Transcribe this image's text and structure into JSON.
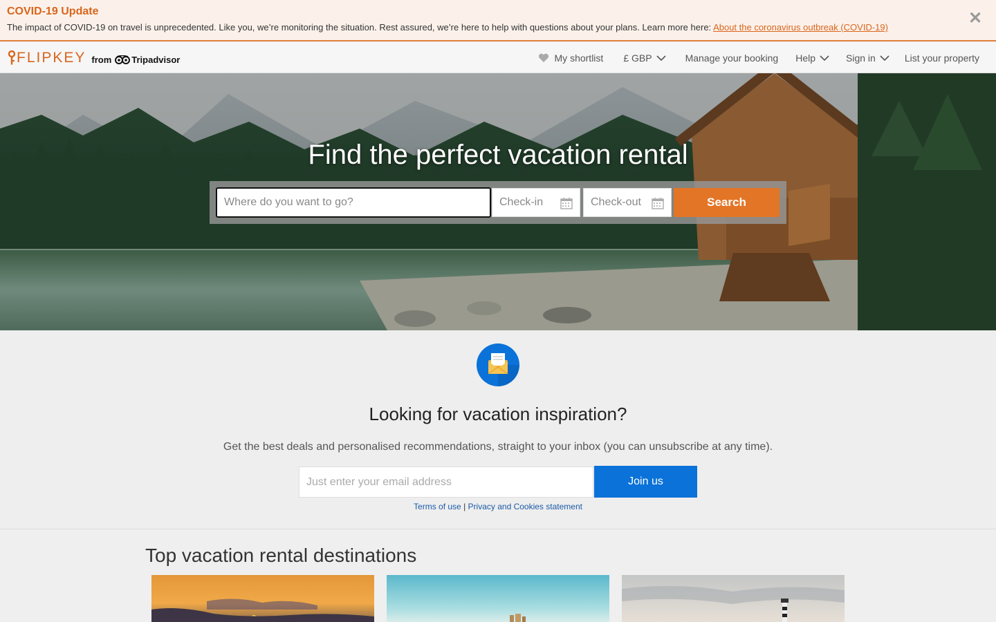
{
  "covid": {
    "title": "COVID-19 Update",
    "text": "The impact of COVID-19 on travel is unprecedented. Like you, we’re monitoring the situation. Rest assured, we’re here to help with questions about your plans. Learn more here: ",
    "link": "About the coronavirus outbreak (COVID-19)",
    "close_icon": "close-icon",
    "close_glyph": "✕"
  },
  "header": {
    "logo": "FLIPKEY",
    "logo_from": "from",
    "logo_brand": "Tripadvisor",
    "nav": {
      "shortlist": "My shortlist",
      "currency": "£ GBP",
      "manage": "Manage your booking",
      "help": "Help",
      "signin": "Sign in",
      "list": "List your property"
    }
  },
  "hero": {
    "title": "Find the perfect vacation rental",
    "where_placeholder": "Where do you want to go?",
    "checkin_placeholder": "Check-in",
    "checkout_placeholder": "Check-out",
    "search_label": "Search"
  },
  "newsletter": {
    "title": "Looking for vacation inspiration?",
    "subtitle": "Get the best deals and personalised recommendations, straight to your inbox (you can unsubscribe at any time).",
    "email_placeholder": "Just enter your email address",
    "join_label": "Join us",
    "terms": "Terms of use",
    "separator": "|",
    "privacy": "Privacy and Cookies statement"
  },
  "destinations": {
    "title": "Top vacation rental destinations"
  },
  "colors": {
    "brand_orange": "#d9651c",
    "search_orange": "#e37527",
    "join_blue": "#0b72d9",
    "link_blue": "#1a5aa8"
  }
}
